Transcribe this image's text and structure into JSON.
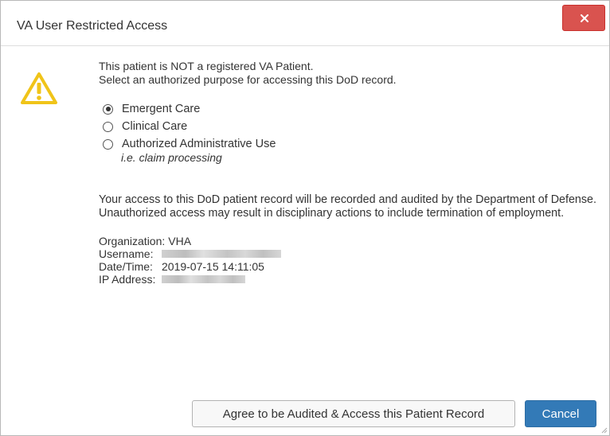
{
  "dialog": {
    "title": "VA User Restricted Access",
    "close_icon": "close-icon"
  },
  "message": {
    "line1": "This patient is NOT a registered VA Patient.",
    "line2": "Select an authorized purpose for accessing this DoD record.",
    "icon": "warning-triangle-icon",
    "icon_color": "#f0c419"
  },
  "purposes": {
    "selected": "Emergent Care",
    "options": [
      {
        "label": "Emergent Care",
        "checked": true,
        "hint": ""
      },
      {
        "label": "Clinical Care",
        "checked": false,
        "hint": ""
      },
      {
        "label": "Authorized Administrative Use",
        "checked": false,
        "hint": "i.e. claim processing"
      }
    ]
  },
  "audit_notice": "Your access to this DoD patient record will be recorded and audited by the Department of Defense. Unauthorized access may result in disciplinary actions to include termination of employment.",
  "info": {
    "organization_label": "Organization:",
    "organization_value": "VHA",
    "username_label": "Username:",
    "datetime_label": "Date/Time:",
    "datetime_value": "2019-07-15 14:11:05",
    "ip_label": "IP Address:"
  },
  "buttons": {
    "agree_label": "Agree to be Audited & Access this Patient Record",
    "cancel_label": "Cancel"
  },
  "colors": {
    "close_button": "#d9534f",
    "primary_button": "#337ab7"
  }
}
